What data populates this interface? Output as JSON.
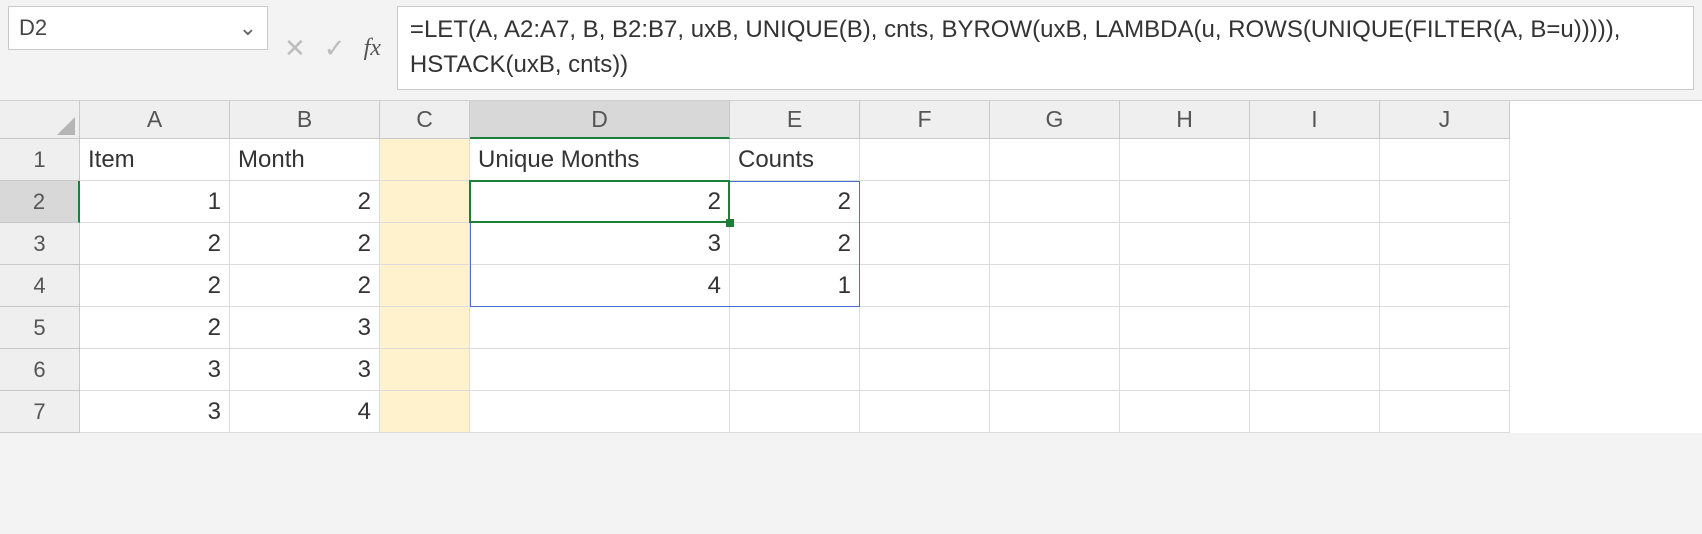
{
  "name_box": {
    "value": "D2",
    "dropdown_glyph": "⌄"
  },
  "fb_buttons": {
    "cancel": "✕",
    "confirm": "✓",
    "fx": "fx"
  },
  "formula": "=LET(A, A2:A7, B, B2:B7, uxB, UNIQUE(B), cnts, BYROW(uxB, LAMBDA(u, ROWS(UNIQUE(FILTER(A, B=u))))), HSTACK(uxB, cnts))",
  "columns": [
    "A",
    "B",
    "C",
    "D",
    "E",
    "F",
    "G",
    "H",
    "I",
    "J"
  ],
  "active_column": "D",
  "row_numbers": [
    "1",
    "2",
    "3",
    "4",
    "5",
    "6",
    "7"
  ],
  "active_row": "2",
  "headers": {
    "A1": "Item",
    "B1": "Month",
    "D1": "Unique Months",
    "E1": "Counts"
  },
  "data": {
    "A": [
      "1",
      "2",
      "2",
      "2",
      "3",
      "3"
    ],
    "B": [
      "2",
      "2",
      "2",
      "3",
      "3",
      "4"
    ],
    "D": [
      "2",
      "3",
      "4"
    ],
    "E": [
      "2",
      "2",
      "1"
    ]
  },
  "highlight_column": "C",
  "chart_data": {
    "type": "table",
    "source_table": {
      "columns": [
        "Item",
        "Month"
      ],
      "rows": [
        [
          1,
          2
        ],
        [
          2,
          2
        ],
        [
          2,
          2
        ],
        [
          2,
          3
        ],
        [
          3,
          3
        ],
        [
          3,
          4
        ]
      ]
    },
    "result_table": {
      "columns": [
        "Unique Months",
        "Counts"
      ],
      "rows": [
        [
          2,
          2
        ],
        [
          3,
          2
        ],
        [
          4,
          1
        ]
      ]
    }
  }
}
